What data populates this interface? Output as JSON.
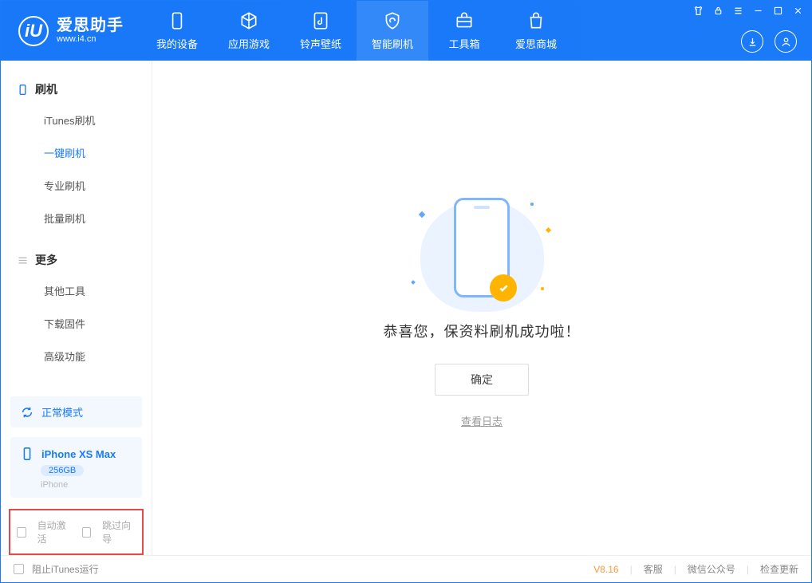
{
  "app": {
    "name_cn": "爱思助手",
    "name_en": "www.i4.cn",
    "logo_letter": "iU"
  },
  "nav": {
    "items": [
      {
        "label": "我的设备"
      },
      {
        "label": "应用游戏"
      },
      {
        "label": "铃声壁纸"
      },
      {
        "label": "智能刷机"
      },
      {
        "label": "工具箱"
      },
      {
        "label": "爱思商城"
      }
    ]
  },
  "sidebar": {
    "group1_title": "刷机",
    "group1_items": [
      "iTunes刷机",
      "一键刷机",
      "专业刷机",
      "批量刷机"
    ],
    "group2_title": "更多",
    "group2_items": [
      "其他工具",
      "下载固件",
      "高级功能"
    ],
    "mode_label": "正常模式",
    "device_name": "iPhone XS Max",
    "device_storage": "256GB",
    "device_type": "iPhone",
    "cb_auto_activate": "自动激活",
    "cb_skip_guide": "跳过向导"
  },
  "main": {
    "success_text": "恭喜您，保资料刷机成功啦！",
    "ok_button": "确定",
    "view_log": "查看日志"
  },
  "footer": {
    "block_itunes": "阻止iTunes运行",
    "version": "V8.16",
    "service": "客服",
    "wechat": "微信公众号",
    "check_update": "检查更新"
  }
}
